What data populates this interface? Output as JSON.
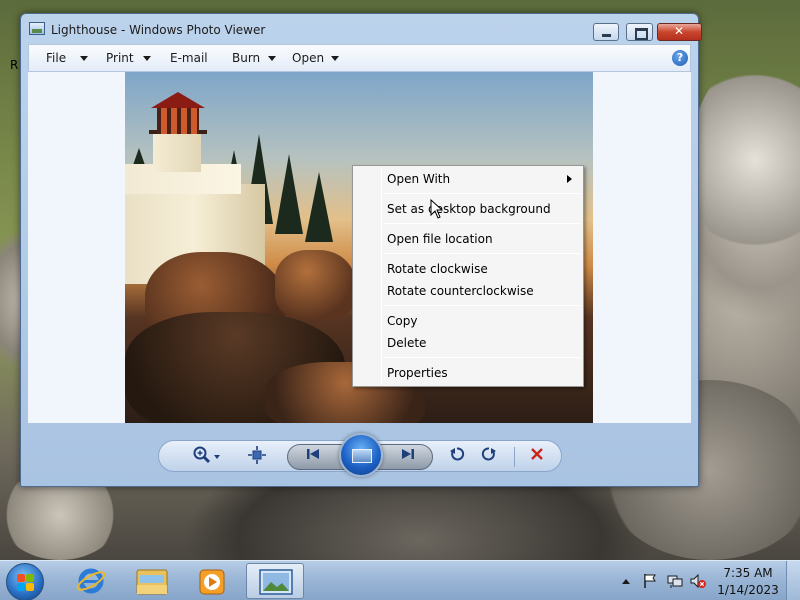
{
  "window": {
    "title": "Lighthouse - Windows Photo Viewer"
  },
  "menubar": {
    "items": [
      {
        "label": "File",
        "has_dropdown": true
      },
      {
        "label": "Print",
        "has_dropdown": true
      },
      {
        "label": "E-mail",
        "has_dropdown": false
      },
      {
        "label": "Burn",
        "has_dropdown": true
      },
      {
        "label": "Open",
        "has_dropdown": true
      }
    ],
    "help_glyph": "?"
  },
  "background_fragment": "R",
  "context_menu": {
    "items": [
      {
        "label": "Open With",
        "submenu": true
      },
      {
        "label": "Set as desktop background"
      },
      {
        "label": "Open file location"
      },
      {
        "label": "Rotate clockwise"
      },
      {
        "label": "Rotate counterclockwise"
      },
      {
        "label": "Copy"
      },
      {
        "label": "Delete"
      },
      {
        "label": "Properties"
      }
    ]
  },
  "toolbar": {
    "icons": [
      "zoom-icon",
      "actual-size-icon",
      "previous-icon",
      "slideshow-icon",
      "next-icon",
      "rotate-counterclockwise-icon",
      "rotate-clockwise-icon",
      "delete-icon"
    ]
  },
  "taskbar": {
    "apps": [
      "internet-explorer-icon",
      "windows-explorer-icon",
      "windows-media-player-icon",
      "windows-photo-viewer-icon"
    ],
    "tray": [
      "show-hidden-icons",
      "action-center-icon",
      "network-icon",
      "volume-muted-icon"
    ],
    "time": "7:35 AM",
    "date": "1/14/2023"
  },
  "colors": {
    "accent": "#1e62c6",
    "close_button": "#c9452e",
    "delete_icon": "#c8261b"
  }
}
